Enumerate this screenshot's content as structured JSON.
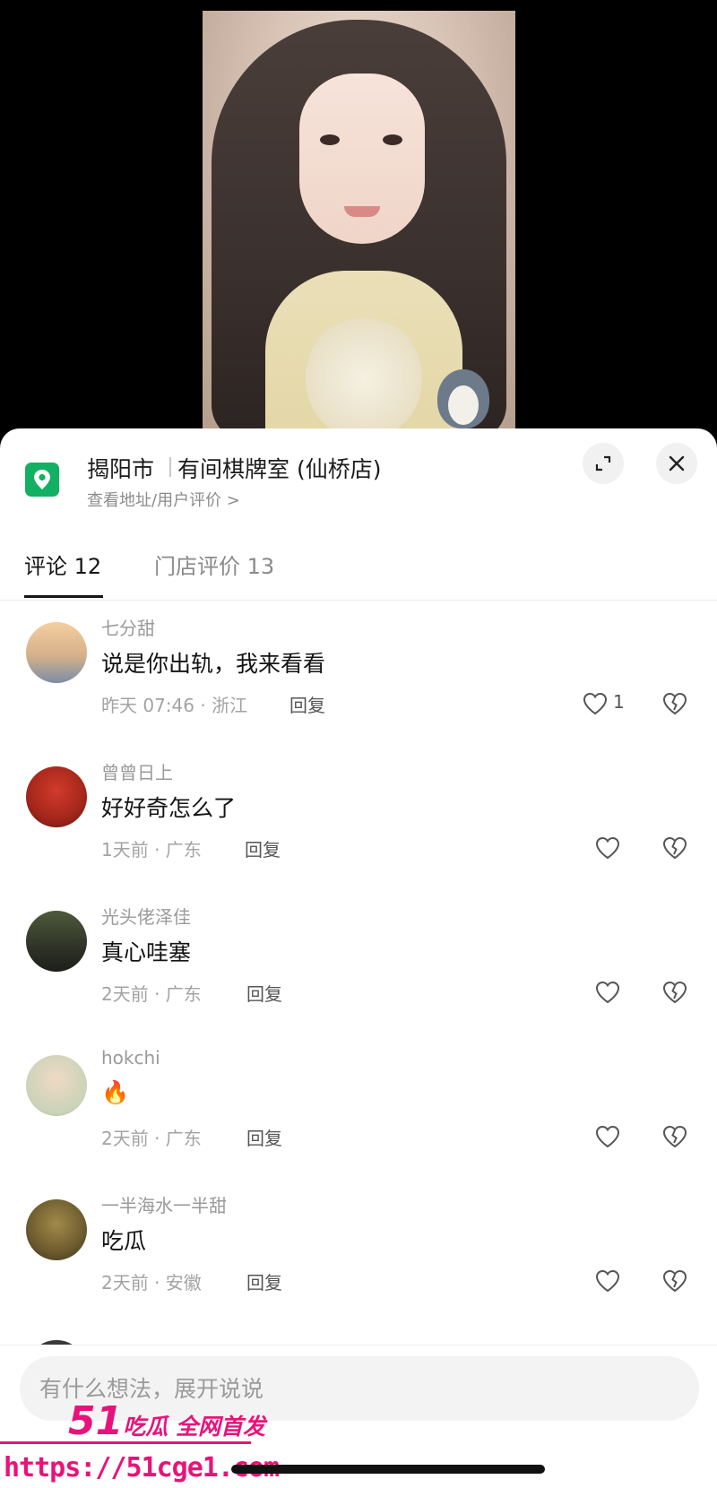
{
  "location": {
    "city": "揭阳市",
    "store": "有间棋牌室 (仙桥店)",
    "subtitle": "查看地址/用户评价 >"
  },
  "tabs": [
    {
      "label": "评论 12",
      "active": true
    },
    {
      "label": "门店评价 13",
      "active": false
    }
  ],
  "comments": [
    {
      "name": "七分甜",
      "text": "说是你出轨，我来看看",
      "meta": "昨天 07:46 · 浙江",
      "reply": "回复",
      "likes": "1"
    },
    {
      "name": "曾曾日上",
      "text": "好好奇怎么了",
      "meta": "1天前 · 广东",
      "reply": "回复",
      "likes": ""
    },
    {
      "name": "光头佬泽佳",
      "text": "真心哇塞",
      "meta": "2天前 · 广东",
      "reply": "回复",
      "likes": ""
    },
    {
      "name": "hokchi",
      "text": "🔥",
      "meta": "2天前 · 广东",
      "reply": "回复",
      "likes": ""
    },
    {
      "name": "一半海水一半甜",
      "text": "吃瓜",
      "meta": "2天前 · 安徽",
      "reply": "回复",
      "likes": ""
    }
  ],
  "input": {
    "placeholder": "有什么想法，展开说说"
  },
  "watermark": {
    "brand_number": "51",
    "brand_text": "吃瓜 全网首发",
    "url": "https://51cge1.com"
  },
  "colors": {
    "location_pin": "#12b062",
    "watermark": "#e8137a"
  },
  "icons": [
    "location-pin-icon",
    "expand-icon",
    "close-icon",
    "heart-icon",
    "broken-heart-icon"
  ]
}
